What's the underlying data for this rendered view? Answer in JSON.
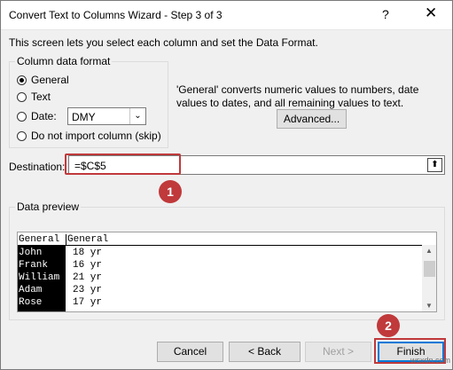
{
  "window": {
    "title": "Convert Text to Columns Wizard - Step 3 of 3",
    "help_glyph": "?",
    "close_glyph": "✕"
  },
  "description": "This screen lets you select each column and set the Data Format.",
  "column_format": {
    "group_label": "Column data format",
    "options": [
      {
        "label": "General",
        "checked": true
      },
      {
        "label": "Text",
        "checked": false
      },
      {
        "label": "Date:",
        "checked": false
      },
      {
        "label": "Do not import column (skip)",
        "checked": false
      }
    ],
    "date_select_value": "DMY",
    "date_select_arrow": "⌄"
  },
  "info": {
    "text": "'General' converts numeric values to numbers, date values to dates, and all remaining values to text.",
    "advanced_label": "Advanced..."
  },
  "destination": {
    "label": "Destination:",
    "value": "=$C$5",
    "collapse_glyph": "⬆"
  },
  "preview": {
    "group_label": "Data preview",
    "headers": [
      "General",
      "General"
    ],
    "rows": [
      [
        "John",
        "18 yr"
      ],
      [
        "Frank",
        "16 yr"
      ],
      [
        "William",
        "21 yr"
      ],
      [
        "Adam",
        "23 yr"
      ],
      [
        "Rose",
        "17 yr"
      ]
    ],
    "scroll_up": "▲",
    "scroll_down": "▼"
  },
  "buttons": {
    "cancel": "Cancel",
    "back": "< Back",
    "next": "Next >",
    "finish": "Finish"
  },
  "annotations": {
    "badge_1": "1",
    "badge_2": "2",
    "color": "#c0393b"
  },
  "watermark": "wsxdn.com"
}
